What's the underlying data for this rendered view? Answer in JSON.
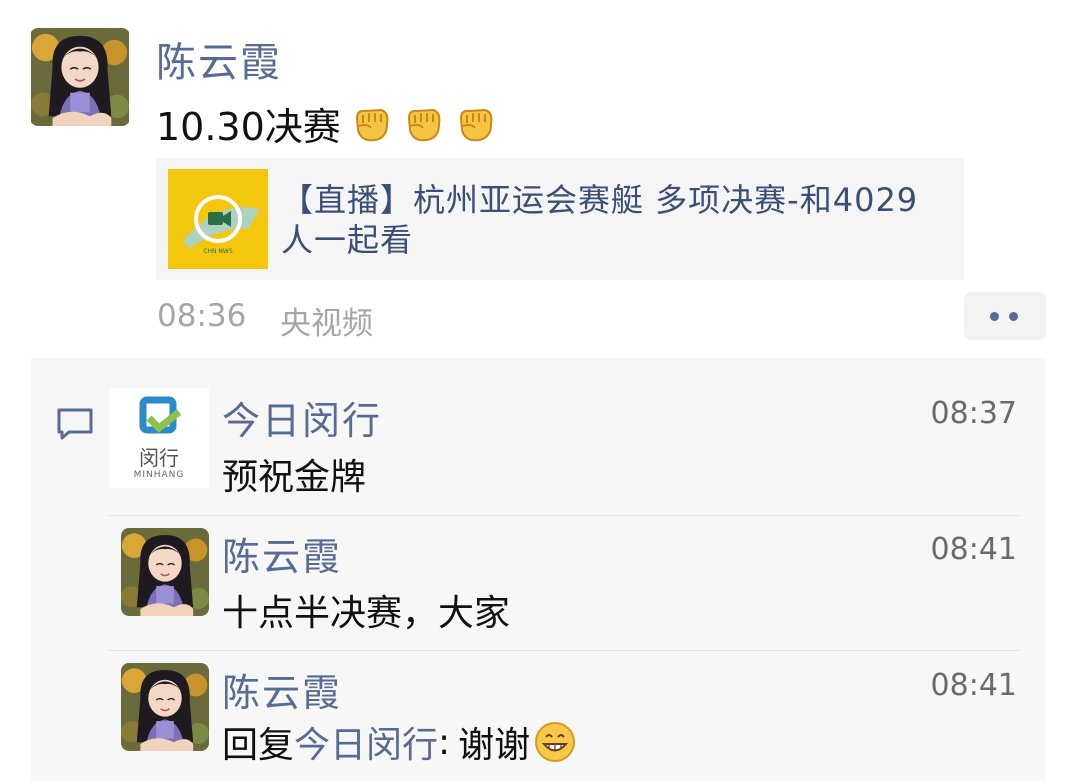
{
  "post": {
    "author": "陈云霞",
    "text": "10.30决赛",
    "emojis": [
      "fist-emoji",
      "fist-emoji",
      "fist-emoji"
    ],
    "link": {
      "title": "【直播】杭州亚运会赛艇 多项决赛-和4029人一起看",
      "thumb_icon": "video-play-icon",
      "thumb_color": "#f3c70e"
    },
    "time": "08:36",
    "source": "央视频",
    "more_icon": "more-dots-icon"
  },
  "comments": [
    {
      "author": "今日闵行",
      "avatar_logo": "闵行",
      "avatar_logo_en": "MINHANG",
      "time": "08:37",
      "text": "预祝金牌"
    },
    {
      "author": "陈云霞",
      "time": "08:41",
      "text": "十点半决赛，大家"
    },
    {
      "author": "陈云霞",
      "time": "08:41",
      "reply_prefix": "回复",
      "reply_to": "今日闵行",
      "reply_sep": ":",
      "text": "谢谢",
      "emoji": "grin-emoji"
    }
  ],
  "colors": {
    "link_name": "#576b95",
    "comment_bg": "#f7f7f7",
    "card_bg": "#f5f5f5"
  }
}
